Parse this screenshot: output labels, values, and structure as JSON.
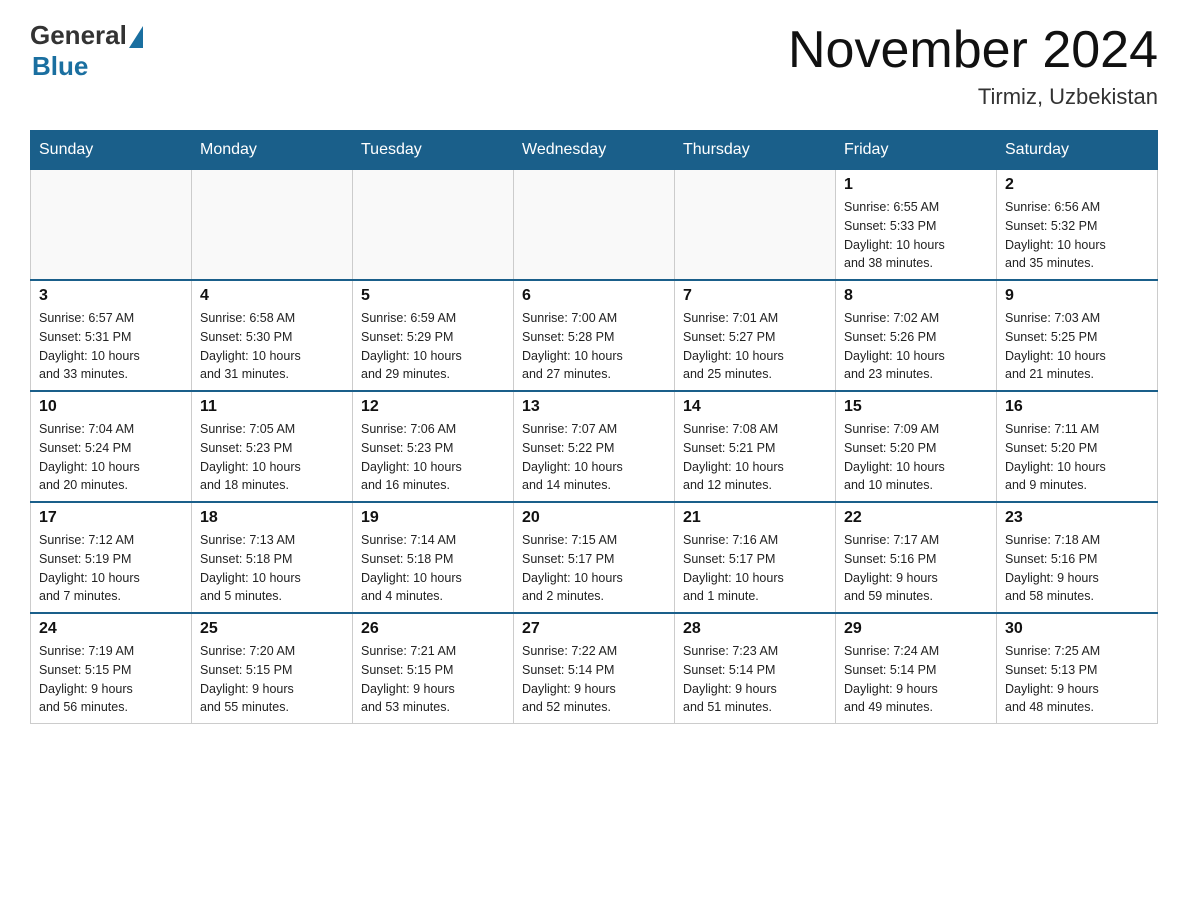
{
  "header": {
    "logo_general": "General",
    "logo_blue": "Blue",
    "month_title": "November 2024",
    "location": "Tirmiz, Uzbekistan"
  },
  "weekdays": [
    "Sunday",
    "Monday",
    "Tuesday",
    "Wednesday",
    "Thursday",
    "Friday",
    "Saturday"
  ],
  "weeks": [
    [
      {
        "day": "",
        "info": ""
      },
      {
        "day": "",
        "info": ""
      },
      {
        "day": "",
        "info": ""
      },
      {
        "day": "",
        "info": ""
      },
      {
        "day": "",
        "info": ""
      },
      {
        "day": "1",
        "info": "Sunrise: 6:55 AM\nSunset: 5:33 PM\nDaylight: 10 hours\nand 38 minutes."
      },
      {
        "day": "2",
        "info": "Sunrise: 6:56 AM\nSunset: 5:32 PM\nDaylight: 10 hours\nand 35 minutes."
      }
    ],
    [
      {
        "day": "3",
        "info": "Sunrise: 6:57 AM\nSunset: 5:31 PM\nDaylight: 10 hours\nand 33 minutes."
      },
      {
        "day": "4",
        "info": "Sunrise: 6:58 AM\nSunset: 5:30 PM\nDaylight: 10 hours\nand 31 minutes."
      },
      {
        "day": "5",
        "info": "Sunrise: 6:59 AM\nSunset: 5:29 PM\nDaylight: 10 hours\nand 29 minutes."
      },
      {
        "day": "6",
        "info": "Sunrise: 7:00 AM\nSunset: 5:28 PM\nDaylight: 10 hours\nand 27 minutes."
      },
      {
        "day": "7",
        "info": "Sunrise: 7:01 AM\nSunset: 5:27 PM\nDaylight: 10 hours\nand 25 minutes."
      },
      {
        "day": "8",
        "info": "Sunrise: 7:02 AM\nSunset: 5:26 PM\nDaylight: 10 hours\nand 23 minutes."
      },
      {
        "day": "9",
        "info": "Sunrise: 7:03 AM\nSunset: 5:25 PM\nDaylight: 10 hours\nand 21 minutes."
      }
    ],
    [
      {
        "day": "10",
        "info": "Sunrise: 7:04 AM\nSunset: 5:24 PM\nDaylight: 10 hours\nand 20 minutes."
      },
      {
        "day": "11",
        "info": "Sunrise: 7:05 AM\nSunset: 5:23 PM\nDaylight: 10 hours\nand 18 minutes."
      },
      {
        "day": "12",
        "info": "Sunrise: 7:06 AM\nSunset: 5:23 PM\nDaylight: 10 hours\nand 16 minutes."
      },
      {
        "day": "13",
        "info": "Sunrise: 7:07 AM\nSunset: 5:22 PM\nDaylight: 10 hours\nand 14 minutes."
      },
      {
        "day": "14",
        "info": "Sunrise: 7:08 AM\nSunset: 5:21 PM\nDaylight: 10 hours\nand 12 minutes."
      },
      {
        "day": "15",
        "info": "Sunrise: 7:09 AM\nSunset: 5:20 PM\nDaylight: 10 hours\nand 10 minutes."
      },
      {
        "day": "16",
        "info": "Sunrise: 7:11 AM\nSunset: 5:20 PM\nDaylight: 10 hours\nand 9 minutes."
      }
    ],
    [
      {
        "day": "17",
        "info": "Sunrise: 7:12 AM\nSunset: 5:19 PM\nDaylight: 10 hours\nand 7 minutes."
      },
      {
        "day": "18",
        "info": "Sunrise: 7:13 AM\nSunset: 5:18 PM\nDaylight: 10 hours\nand 5 minutes."
      },
      {
        "day": "19",
        "info": "Sunrise: 7:14 AM\nSunset: 5:18 PM\nDaylight: 10 hours\nand 4 minutes."
      },
      {
        "day": "20",
        "info": "Sunrise: 7:15 AM\nSunset: 5:17 PM\nDaylight: 10 hours\nand 2 minutes."
      },
      {
        "day": "21",
        "info": "Sunrise: 7:16 AM\nSunset: 5:17 PM\nDaylight: 10 hours\nand 1 minute."
      },
      {
        "day": "22",
        "info": "Sunrise: 7:17 AM\nSunset: 5:16 PM\nDaylight: 9 hours\nand 59 minutes."
      },
      {
        "day": "23",
        "info": "Sunrise: 7:18 AM\nSunset: 5:16 PM\nDaylight: 9 hours\nand 58 minutes."
      }
    ],
    [
      {
        "day": "24",
        "info": "Sunrise: 7:19 AM\nSunset: 5:15 PM\nDaylight: 9 hours\nand 56 minutes."
      },
      {
        "day": "25",
        "info": "Sunrise: 7:20 AM\nSunset: 5:15 PM\nDaylight: 9 hours\nand 55 minutes."
      },
      {
        "day": "26",
        "info": "Sunrise: 7:21 AM\nSunset: 5:15 PM\nDaylight: 9 hours\nand 53 minutes."
      },
      {
        "day": "27",
        "info": "Sunrise: 7:22 AM\nSunset: 5:14 PM\nDaylight: 9 hours\nand 52 minutes."
      },
      {
        "day": "28",
        "info": "Sunrise: 7:23 AM\nSunset: 5:14 PM\nDaylight: 9 hours\nand 51 minutes."
      },
      {
        "day": "29",
        "info": "Sunrise: 7:24 AM\nSunset: 5:14 PM\nDaylight: 9 hours\nand 49 minutes."
      },
      {
        "day": "30",
        "info": "Sunrise: 7:25 AM\nSunset: 5:13 PM\nDaylight: 9 hours\nand 48 minutes."
      }
    ]
  ]
}
